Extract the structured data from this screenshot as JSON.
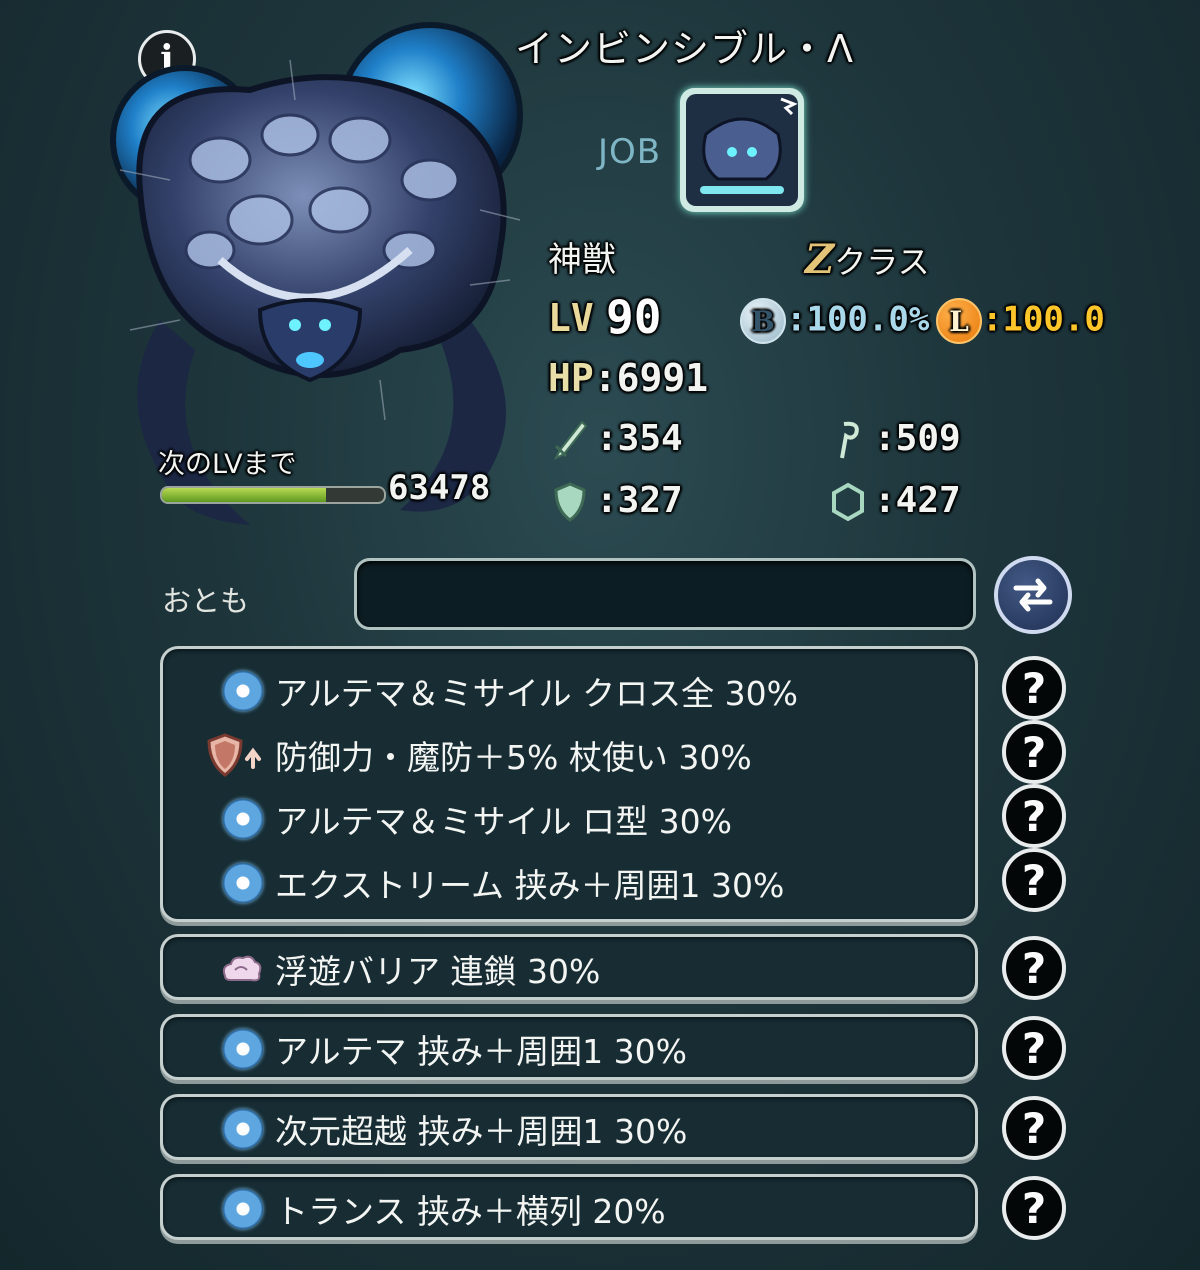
{
  "header": {
    "name": "インビンシブル・Λ",
    "info_glyph": "i"
  },
  "job": {
    "label": "JOB"
  },
  "stats": {
    "species": "神獣",
    "class_letter": "Z",
    "class_suffix": "クラス",
    "lv_label": "LV",
    "lv": "90",
    "b_letter": "B",
    "b_value": ":100.0%",
    "l_letter": "L",
    "l_value": ":100.0",
    "hp_label": "HP",
    "hp_value": ":6991",
    "atk": ":354",
    "mag": ":509",
    "def": ":327",
    "mdef": ":427"
  },
  "exp": {
    "label": "次のLVまで",
    "value": "63478",
    "progress": 0.74
  },
  "partner": {
    "label": "おとも",
    "slot_value": ""
  },
  "abilities_group1": [
    {
      "icon": "circle-bullet-icon",
      "text": "アルテマ＆ミサイル クロス全 30%"
    },
    {
      "icon": "shield-up-icon",
      "text": "防御力・魔防＋5% 杖使い 30%"
    },
    {
      "icon": "circle-bullet-icon",
      "text": "アルテマ＆ミサイル ロ型 30%"
    },
    {
      "icon": "circle-bullet-icon",
      "text": "エクストリーム 挟み＋周囲1 30%"
    }
  ],
  "abilities_single": [
    {
      "icon": "cloud-barrier-icon",
      "text": "浮遊バリア 連鎖 30%"
    },
    {
      "icon": "circle-bullet-icon",
      "text": "アルテマ 挟み＋周囲1 30%"
    },
    {
      "icon": "circle-bullet-icon",
      "text": "次元超越 挟み＋周囲1 30%"
    },
    {
      "icon": "circle-bullet-icon",
      "text": "トランス 挟み＋横列 20%"
    }
  ],
  "help_glyph": "?",
  "colors": {
    "accent_blue": "#5ea6df",
    "gold": "#ffc62a",
    "panel_bg": "#172c33",
    "exp_green": "#8fc13a"
  }
}
